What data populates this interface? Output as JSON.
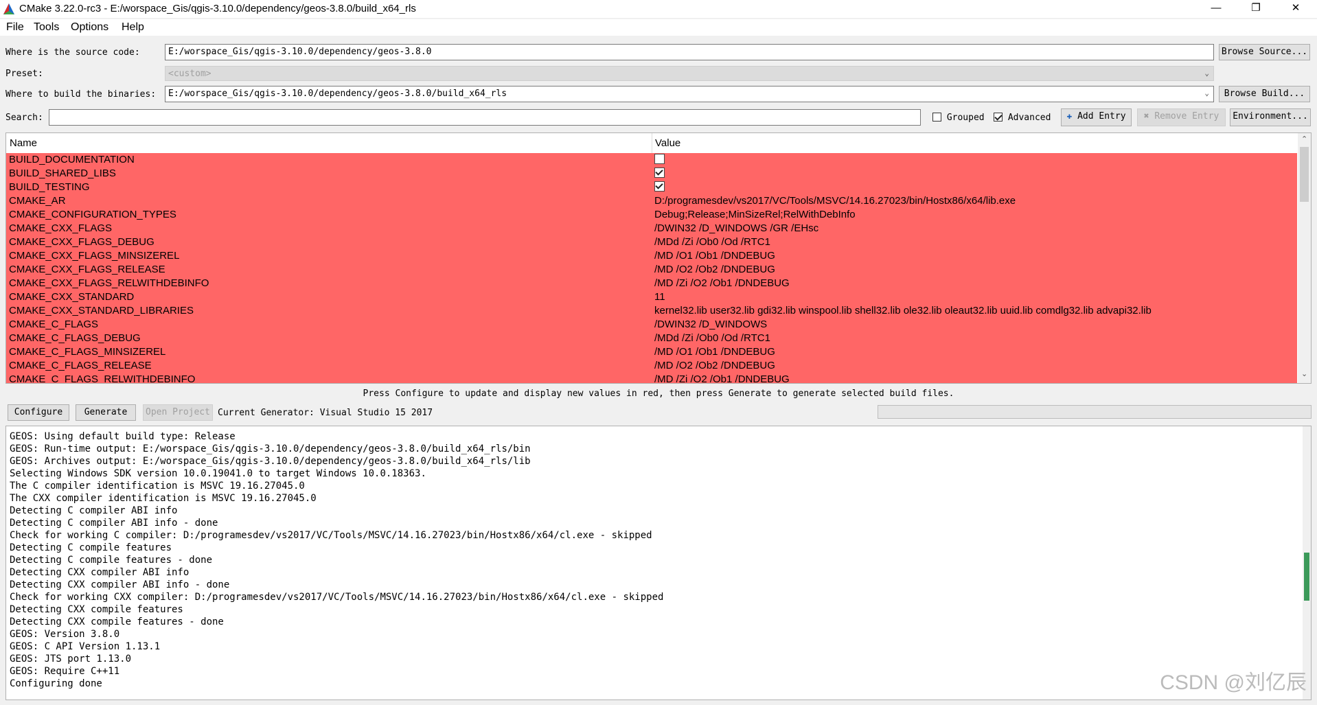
{
  "window": {
    "title": "CMake 3.22.0-rc3 - E:/worspace_Gis/qgis-3.10.0/dependency/geos-3.8.0/build_x64_rls",
    "minimize": "—",
    "restore": "❐",
    "close": "✕"
  },
  "menu": [
    "File",
    "Tools",
    "Options",
    "Help"
  ],
  "source": {
    "label": "Where is the source code:",
    "value": "E:/worspace_Gis/qgis-3.10.0/dependency/geos-3.8.0",
    "browse": "Browse Source..."
  },
  "preset": {
    "label": "Preset:",
    "value": "<custom>"
  },
  "build": {
    "label": "Where to build the binaries:",
    "value": "E:/worspace_Gis/qgis-3.10.0/dependency/geos-3.8.0/build_x64_rls",
    "browse": "Browse Build..."
  },
  "search": {
    "label": "Search:",
    "value": "",
    "grouped": "Grouped",
    "grouped_checked": false,
    "advanced": "Advanced",
    "advanced_checked": true,
    "add_entry": "Add Entry",
    "remove_entry": "Remove Entry",
    "environment": "Environment..."
  },
  "table": {
    "columns": [
      "Name",
      "Value"
    ],
    "highlight_color": "#ff6666",
    "rows": [
      {
        "name": "BUILD_DOCUMENTATION",
        "type": "bool",
        "value": false
      },
      {
        "name": "BUILD_SHARED_LIBS",
        "type": "bool",
        "value": true
      },
      {
        "name": "BUILD_TESTING",
        "type": "bool",
        "value": true
      },
      {
        "name": "CMAKE_AR",
        "type": "text",
        "value": "D:/programesdev/vs2017/VC/Tools/MSVC/14.16.27023/bin/Hostx86/x64/lib.exe"
      },
      {
        "name": "CMAKE_CONFIGURATION_TYPES",
        "type": "text",
        "value": "Debug;Release;MinSizeRel;RelWithDebInfo"
      },
      {
        "name": "CMAKE_CXX_FLAGS",
        "type": "text",
        "value": "/DWIN32 /D_WINDOWS /GR /EHsc"
      },
      {
        "name": "CMAKE_CXX_FLAGS_DEBUG",
        "type": "text",
        "value": "/MDd /Zi /Ob0 /Od /RTC1"
      },
      {
        "name": "CMAKE_CXX_FLAGS_MINSIZEREL",
        "type": "text",
        "value": "/MD /O1 /Ob1 /DNDEBUG"
      },
      {
        "name": "CMAKE_CXX_FLAGS_RELEASE",
        "type": "text",
        "value": "/MD /O2 /Ob2 /DNDEBUG"
      },
      {
        "name": "CMAKE_CXX_FLAGS_RELWITHDEBINFO",
        "type": "text",
        "value": "/MD /Zi /O2 /Ob1 /DNDEBUG"
      },
      {
        "name": "CMAKE_CXX_STANDARD",
        "type": "text",
        "value": "11"
      },
      {
        "name": "CMAKE_CXX_STANDARD_LIBRARIES",
        "type": "text",
        "value": "kernel32.lib user32.lib gdi32.lib winspool.lib shell32.lib ole32.lib oleaut32.lib uuid.lib comdlg32.lib advapi32.lib"
      },
      {
        "name": "CMAKE_C_FLAGS",
        "type": "text",
        "value": "/DWIN32 /D_WINDOWS"
      },
      {
        "name": "CMAKE_C_FLAGS_DEBUG",
        "type": "text",
        "value": "/MDd /Zi /Ob0 /Od /RTC1"
      },
      {
        "name": "CMAKE_C_FLAGS_MINSIZEREL",
        "type": "text",
        "value": "/MD /O1 /Ob1 /DNDEBUG"
      },
      {
        "name": "CMAKE_C_FLAGS_RELEASE",
        "type": "text",
        "value": "/MD /O2 /Ob2 /DNDEBUG"
      },
      {
        "name": "CMAKE_C_FLAGS_RELWITHDEBINFO",
        "type": "text",
        "value": "/MD /Zi /O2 /Ob1 /DNDEBUG"
      }
    ]
  },
  "hint": "Press Configure to update and display new values in red, then press Generate to generate selected build files.",
  "actions": {
    "configure": "Configure",
    "generate": "Generate",
    "open_project": "Open Project",
    "generator": "Current Generator: Visual Studio 15 2017"
  },
  "output": [
    "GEOS: Using default build type: Release",
    "GEOS: Run-time output: E:/worspace_Gis/qgis-3.10.0/dependency/geos-3.8.0/build_x64_rls/bin",
    "GEOS: Archives output: E:/worspace_Gis/qgis-3.10.0/dependency/geos-3.8.0/build_x64_rls/lib",
    "Selecting Windows SDK version 10.0.19041.0 to target Windows 10.0.18363.",
    "The C compiler identification is MSVC 19.16.27045.0",
    "The CXX compiler identification is MSVC 19.16.27045.0",
    "Detecting C compiler ABI info",
    "Detecting C compiler ABI info - done",
    "Check for working C compiler: D:/programesdev/vs2017/VC/Tools/MSVC/14.16.27023/bin/Hostx86/x64/cl.exe - skipped",
    "Detecting C compile features",
    "Detecting C compile features - done",
    "Detecting CXX compiler ABI info",
    "Detecting CXX compiler ABI info - done",
    "Check for working CXX compiler: D:/programesdev/vs2017/VC/Tools/MSVC/14.16.27023/bin/Hostx86/x64/cl.exe - skipped",
    "Detecting CXX compile features",
    "Detecting CXX compile features - done",
    "GEOS: Version 3.8.0",
    "GEOS: C API Version 1.13.1",
    "GEOS: JTS port 1.13.0",
    "GEOS: Require C++11",
    "Configuring done"
  ],
  "watermark": "CSDN @刘亿辰"
}
